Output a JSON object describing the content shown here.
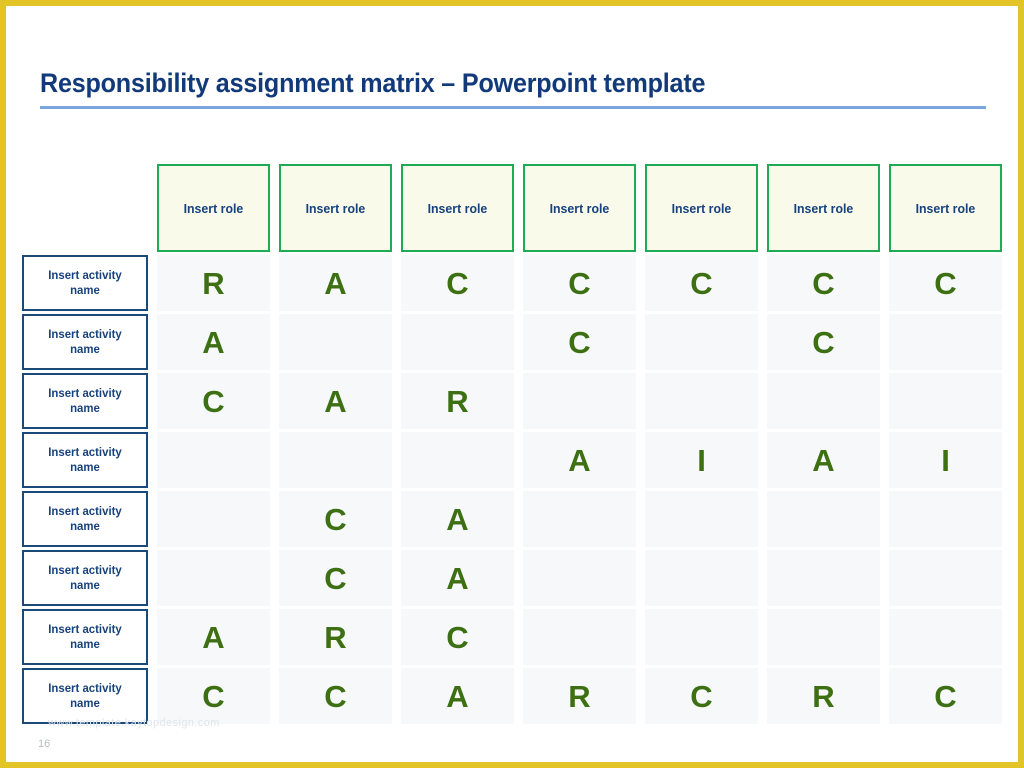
{
  "slide": {
    "title": "Responsibility assignment matrix – Powerpoint template",
    "page_number": "16",
    "watermark": "www.template.kaytopdesign.com",
    "border_color": "#e3c427",
    "title_color": "#123a7a",
    "title_rule_color": "#7ba6dd"
  },
  "matrix": {
    "role_header_text": "Insert role",
    "activity_label_text": "Insert activity name",
    "role_border_color": "#1faa55",
    "role_fill_color": "#f9faea",
    "activity_border_color": "#1b4a7a",
    "activity_fill_color": "#ffffff",
    "cell_fill_color": "#f7f8fa",
    "letter_color": "#3d7012",
    "columns": [
      {
        "label": "Insert role"
      },
      {
        "label": "Insert role"
      },
      {
        "label": "Insert role"
      },
      {
        "label": "Insert role"
      },
      {
        "label": "Insert role"
      },
      {
        "label": "Insert role"
      },
      {
        "label": "Insert role"
      }
    ],
    "rows": [
      {
        "activity": "Insert activity name",
        "values": [
          "R",
          "A",
          "C",
          "C",
          "C",
          "C",
          "C"
        ]
      },
      {
        "activity": "Insert activity name",
        "values": [
          "A",
          "",
          "",
          "C",
          "",
          "C",
          ""
        ]
      },
      {
        "activity": "Insert activity name",
        "values": [
          "C",
          "A",
          "R",
          "",
          "",
          "",
          ""
        ]
      },
      {
        "activity": "Insert activity name",
        "values": [
          "",
          "",
          "",
          "A",
          "I",
          "A",
          "I"
        ]
      },
      {
        "activity": "Insert activity name",
        "values": [
          "",
          "C",
          "A",
          "",
          "",
          "",
          ""
        ]
      },
      {
        "activity": "Insert activity name",
        "values": [
          "",
          "C",
          "A",
          "",
          "",
          "",
          ""
        ]
      },
      {
        "activity": "Insert activity name",
        "values": [
          "A",
          "R",
          "C",
          "",
          "",
          "",
          ""
        ]
      },
      {
        "activity": "Insert activity name",
        "values": [
          "C",
          "C",
          "A",
          "R",
          "C",
          "R",
          "C"
        ]
      }
    ]
  }
}
